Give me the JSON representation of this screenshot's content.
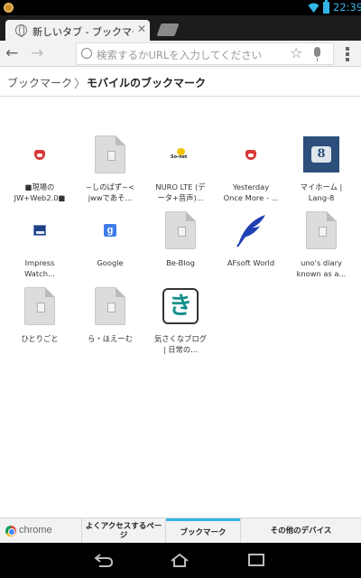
{
  "status_bar": {
    "time": "22:39"
  },
  "tab": {
    "title": "新しいタブ - ブックマーク",
    "close_glyph": "✕"
  },
  "toolbar": {
    "back_glyph": "←",
    "forward_glyph": "→",
    "omnibox_placeholder": "検索するかURLを入力してください",
    "star_glyph": "☆"
  },
  "breadcrumb": {
    "root": "ブックマーク",
    "separator": "〉",
    "current": "モバイルのブックマーク"
  },
  "bookmarks": [
    {
      "label": "■現場の\nJW+Web2.0■",
      "icon": "fox-favicon"
    },
    {
      "label": "~しのばず~<\njwwであそ...",
      "icon": "document-icon"
    },
    {
      "label": "NURO LTE (デ\nータ+音声)...",
      "icon": "so-net-favicon"
    },
    {
      "label": "Yesterday\nOnce More - ...",
      "icon": "fox-favicon"
    },
    {
      "label": "マイホーム |\nLang-8",
      "icon": "lang8-favicon"
    },
    {
      "label": "Impress\nWatch...",
      "icon": "impress-favicon"
    },
    {
      "label": "Google",
      "icon": "google-favicon"
    },
    {
      "label": "Be-Blog",
      "icon": "document-icon"
    },
    {
      "label": "AFsoft World",
      "icon": "feather-favicon"
    },
    {
      "label": "uno's diary\nknown as a...",
      "icon": "document-icon"
    },
    {
      "label": "ひとりごと",
      "icon": "document-icon"
    },
    {
      "label": "ら・ほえーむ",
      "icon": "document-icon"
    },
    {
      "label": "気さくなブログ\n| 日常の...",
      "icon": "ki-favicon",
      "icon_text": "き"
    }
  ],
  "bottom_nav": {
    "brand": "chrome",
    "tabs": [
      {
        "label": "よくアクセスするページ",
        "active": false
      },
      {
        "label": "ブックマーク",
        "active": true
      },
      {
        "label": "その他のデバイス",
        "active": false
      }
    ],
    "accent_color": "#33b5e5"
  }
}
